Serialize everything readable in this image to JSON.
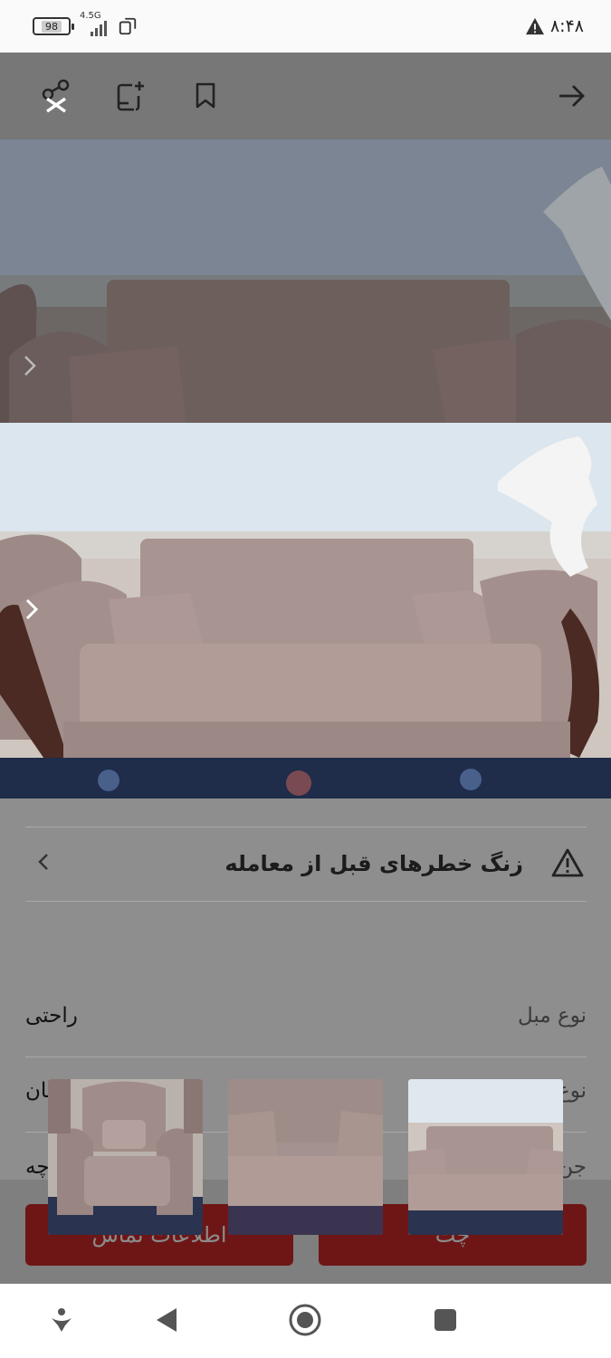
{
  "status_bar": {
    "battery_level": "98",
    "network_label": "4.5G",
    "time": "۸:۴۸"
  },
  "top_bar": {
    "icons": [
      "close-icon",
      "share-icon",
      "add-note-icon",
      "bookmark-icon",
      "back-arrow-icon"
    ]
  },
  "safety": {
    "warning_text": "زنگ خطرهای قبل از معامله"
  },
  "attributes": [
    {
      "key": "نوع مبل",
      "value": "راحتی"
    },
    {
      "key": "نوع کالا",
      "value": "مبلمان"
    },
    {
      "key": "جن",
      "value": "چه"
    }
  ],
  "actions": {
    "contact_label": "اطلاعات تماس",
    "chat_label": "چت"
  },
  "thumbnails": [
    "armchair",
    "sofa-closeup",
    "sofa-full"
  ],
  "colors": {
    "overlay": "#8e8e8e",
    "button": "#6e1616",
    "status_bg": "#fafafa"
  }
}
